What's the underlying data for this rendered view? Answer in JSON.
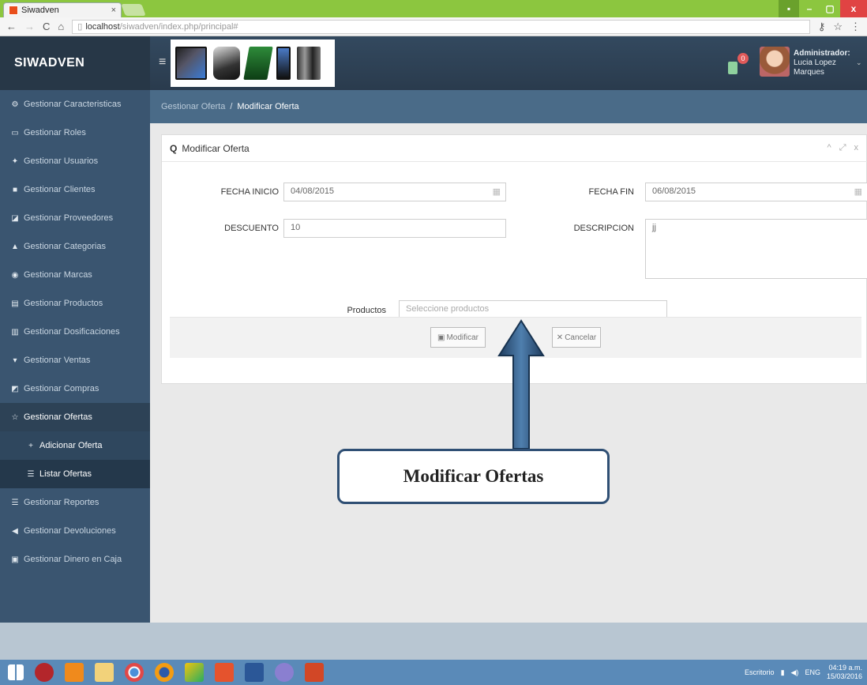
{
  "browser": {
    "tab_title": "Siwadven",
    "tab_close": "×",
    "url_host": "localhost",
    "url_path": "/siwadven/index.php/principal#",
    "window_buttons": [
      "▪",
      "–",
      "▢",
      "x"
    ]
  },
  "header": {
    "brand": "SIWADVEN",
    "menu_toggle": "≡",
    "notification_count": "0",
    "user_role": "Administrador:",
    "user_name": "Lucia Lopez Marques"
  },
  "sidebar": {
    "items": [
      {
        "label": "Gestionar Caracteristicas",
        "icon": "⚙"
      },
      {
        "label": "Gestionar Roles",
        "icon": "▭"
      },
      {
        "label": "Gestionar Usuarios",
        "icon": "✦"
      },
      {
        "label": "Gestionar Clientes",
        "icon": "■"
      },
      {
        "label": "Gestionar Proveedores",
        "icon": "◪"
      },
      {
        "label": "Gestionar Categorias",
        "icon": "▲"
      },
      {
        "label": "Gestionar Marcas",
        "icon": "◉"
      },
      {
        "label": "Gestionar Productos",
        "icon": "▤"
      },
      {
        "label": "Gestionar Dosificaciones",
        "icon": "▥"
      },
      {
        "label": "Gestionar Ventas",
        "icon": "▾"
      },
      {
        "label": "Gestionar Compras",
        "icon": "◩"
      },
      {
        "label": "Gestionar Ofertas",
        "icon": "☆"
      },
      {
        "label": "Adicionar Oferta",
        "icon": "+"
      },
      {
        "label": "Listar Ofertas",
        "icon": "☰"
      },
      {
        "label": "Gestionar Reportes",
        "icon": "☰"
      },
      {
        "label": "Gestionar Devoluciones",
        "icon": "◀"
      },
      {
        "label": "Gestionar Dinero en Caja",
        "icon": "▣"
      }
    ]
  },
  "breadcrumb": {
    "parent": "Gestionar Oferta",
    "separator": "/",
    "current": "Modificar Oferta"
  },
  "panel": {
    "search_glyph": "Q",
    "title": "Modificar Oferta",
    "tools": [
      "^",
      "⤢",
      "x"
    ]
  },
  "form": {
    "fecha_inicio_label": "FECHA INICIO",
    "fecha_inicio_value": "04/08/2015",
    "fecha_fin_label": "FECHA FIN",
    "fecha_fin_value": "06/08/2015",
    "descuento_label": "DESCUENTO",
    "descuento_value": "10",
    "descripcion_label": "DESCRIPCION",
    "descripcion_value": "jj",
    "productos_label": "Productos",
    "productos_placeholder": "Seleccione productos",
    "modificar_label": "Modificar",
    "cancelar_label": "Cancelar"
  },
  "annotation": {
    "callout_text": "Modificar Ofertas"
  },
  "taskbar": {
    "tray_text": "Escritorio",
    "lang": "ENG",
    "time": "04:19 a.m.",
    "date": "15/03/2016"
  }
}
